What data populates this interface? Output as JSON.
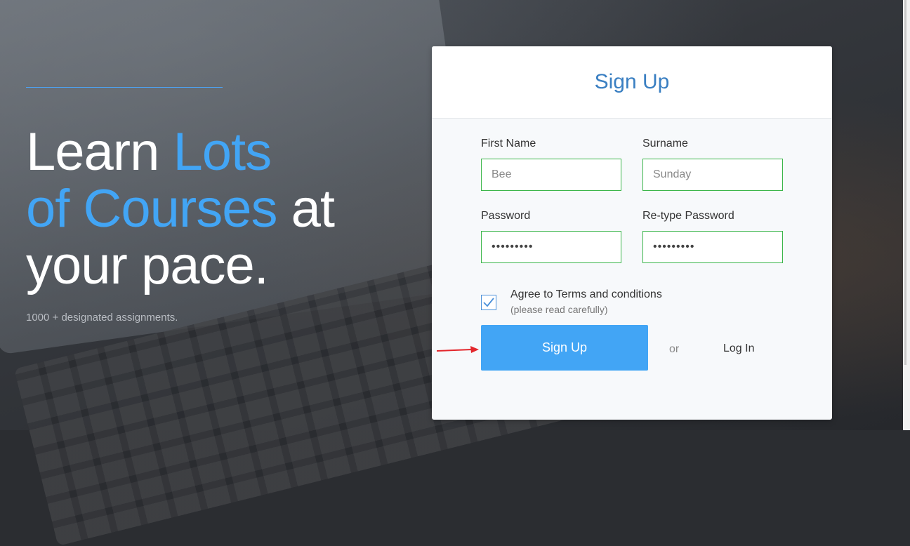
{
  "hero": {
    "line1_plain": "Learn ",
    "line1_highlight": "Lots",
    "line2_highlight": "of Courses",
    "line2_plain": " at",
    "line3_plain": "your pace.",
    "subtitle": "1000 + designated assignments."
  },
  "form": {
    "title": "Sign Up",
    "first_name": {
      "label": "First Name",
      "value": "Bee"
    },
    "surname": {
      "label": "Surname",
      "value": "Sunday"
    },
    "password": {
      "label": "Password",
      "value": "password1"
    },
    "retype_password": {
      "label": "Re-type Password",
      "value": "password1"
    },
    "agree": {
      "label": "Agree to Terms and conditions",
      "note": "(please read carefully)",
      "checked": true
    },
    "submit_label": "Sign Up",
    "or_text": "or",
    "login_label": "Log In"
  },
  "colors": {
    "accent": "#42a5f5",
    "title": "#3a7fc2",
    "input_border": "#3ab54a",
    "annotation_arrow": "#e3262b"
  }
}
